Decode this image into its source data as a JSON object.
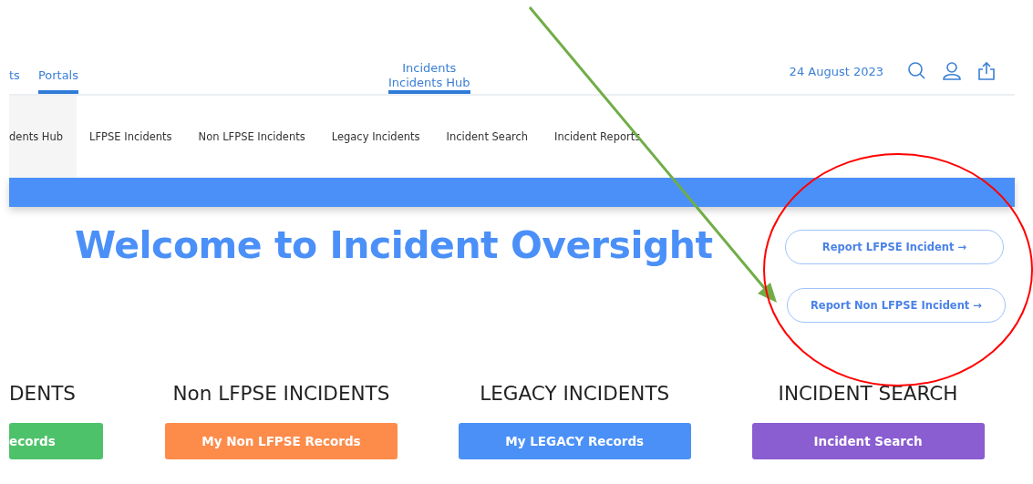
{
  "top_nav": {
    "items": [
      {
        "label": "ts",
        "selected": false
      },
      {
        "label": "Portals",
        "selected": true
      }
    ],
    "center": {
      "line1": "Incidents",
      "line2": "Incidents Hub",
      "selected": true
    },
    "date": "24 August 2023"
  },
  "sub_nav": {
    "items": [
      {
        "label": "dents Hub",
        "selected": true
      },
      {
        "label": "LFPSE Incidents",
        "selected": false
      },
      {
        "label": "Non LFPSE Incidents",
        "selected": false
      },
      {
        "label": "Legacy Incidents",
        "selected": false
      },
      {
        "label": "Incident Search",
        "selected": false
      },
      {
        "label": "Incident Reports",
        "selected": false
      }
    ]
  },
  "hero": {
    "title": "Welcome to Incident Oversight",
    "actions": [
      "Report LFPSE Incident →",
      "Report Non LFPSE Incident →"
    ]
  },
  "sections": [
    {
      "heading": "DENTS",
      "button": "ecords",
      "color": "#4ec26a"
    },
    {
      "heading": "Non LFPSE INCIDENTS",
      "button": "My Non LFPSE Records",
      "color": "#fd8c4b"
    },
    {
      "heading": "LEGACY INCIDENTS",
      "button": "My LEGACY Records",
      "color": "#4a90f7"
    },
    {
      "heading": "INCIDENT SEARCH",
      "button": "Incident Search",
      "color": "#8a5dd1"
    }
  ],
  "annotations": [
    {
      "kind": "arrow",
      "color": "#70ad47"
    },
    {
      "kind": "ellipse",
      "color": "#ff0000"
    }
  ]
}
